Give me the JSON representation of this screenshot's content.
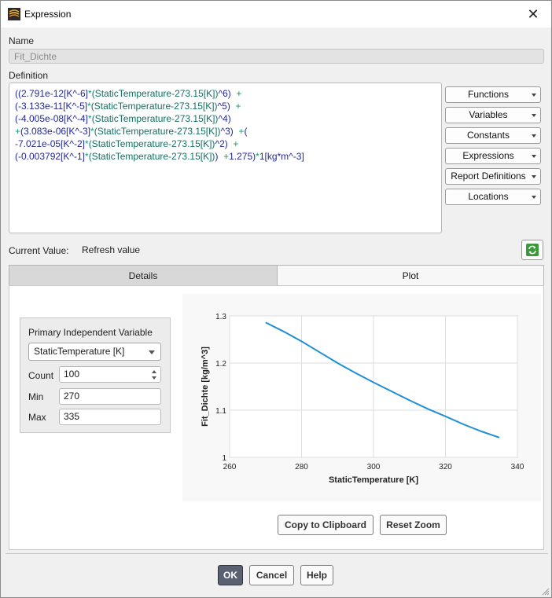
{
  "window": {
    "title": "Expression",
    "close_glyph": "✕"
  },
  "name": {
    "label": "Name",
    "value": "Fit_Dichte"
  },
  "definition": {
    "label": "Definition",
    "lines": [
      [
        [
          "p",
          "(("
        ],
        [
          "n",
          "2.791e-12[K^-6]"
        ],
        [
          "op",
          "*"
        ],
        [
          "v",
          "(StaticTemperature-273.15[K])"
        ],
        [
          "p",
          "^6)  "
        ],
        [
          "op",
          "+"
        ]
      ],
      [
        [
          "n",
          "(-3.133e-11[K^-5]"
        ],
        [
          "op",
          "*"
        ],
        [
          "v",
          "(StaticTemperature-273.15[K])"
        ],
        [
          "p",
          "^5)  "
        ],
        [
          "op",
          "+"
        ]
      ],
      [
        [
          "n",
          "(-4.005e-08[K^-4]"
        ],
        [
          "op",
          "*"
        ],
        [
          "v",
          "(StaticTemperature-273.15[K])"
        ],
        [
          "p",
          "^4)"
        ]
      ],
      [
        [
          "op",
          "+"
        ],
        [
          "n",
          "(3.083e-06[K^-3]"
        ],
        [
          "op",
          "*"
        ],
        [
          "v",
          "(StaticTemperature-273.15[K])"
        ],
        [
          "p",
          "^3)  "
        ],
        [
          "op",
          "+"
        ],
        [
          "p",
          "("
        ]
      ],
      [
        [
          "n",
          "-7.021e-05[K^-2]"
        ],
        [
          "op",
          "*"
        ],
        [
          "v",
          "(StaticTemperature-273.15[K])"
        ],
        [
          "p",
          "^2)  "
        ],
        [
          "op",
          "+"
        ]
      ],
      [
        [
          "n",
          "(-0.003792[K^-1]"
        ],
        [
          "op",
          "*"
        ],
        [
          "v",
          "(StaticTemperature-273.15[K])"
        ],
        [
          "p",
          ")  "
        ],
        [
          "op",
          "+"
        ],
        [
          "n",
          "1.275)"
        ],
        [
          "op",
          "*"
        ],
        [
          "n",
          "1[kg*m^-3]"
        ]
      ]
    ]
  },
  "side_buttons": {
    "functions": "Functions",
    "variables": "Variables",
    "constants": "Constants",
    "expressions": "Expressions",
    "report_definitions": "Report Definitions",
    "locations": "Locations"
  },
  "current_value": {
    "label": "Current Value:",
    "value": "Refresh value"
  },
  "tabs": {
    "details": "Details",
    "plot": "Plot"
  },
  "plot_settings": {
    "group_label": "Primary Independent Variable",
    "variable": "StaticTemperature [K]",
    "count_label": "Count",
    "count": "100",
    "min_label": "Min",
    "min": "270",
    "max_label": "Max",
    "max": "335"
  },
  "chart_data": {
    "type": "line",
    "xlabel": "StaticTemperature [K]",
    "ylabel": "Fit_Dichte [kg/m^3]",
    "xlim": [
      260,
      340
    ],
    "ylim": [
      1,
      1.3
    ],
    "xticks": [
      "260",
      "280",
      "300",
      "320",
      "340"
    ],
    "yticks": [
      "1",
      "1.1",
      "1.2",
      "1.3"
    ],
    "grid": true,
    "line_color": "#1f8fd6",
    "x": [
      270,
      275,
      280,
      285,
      290,
      295,
      300,
      305,
      310,
      315,
      320,
      325,
      330,
      335
    ],
    "y": [
      1.286,
      1.267,
      1.246,
      1.223,
      1.2,
      1.179,
      1.159,
      1.14,
      1.121,
      1.103,
      1.087,
      1.07,
      1.055,
      1.042
    ]
  },
  "plot_buttons": {
    "copy": "Copy to Clipboard",
    "reset": "Reset Zoom"
  },
  "footer": {
    "ok": "OK",
    "cancel": "Cancel",
    "help": "Help"
  },
  "colors": {
    "accent": "#5a6272",
    "plot_line": "#1f8fd6"
  }
}
